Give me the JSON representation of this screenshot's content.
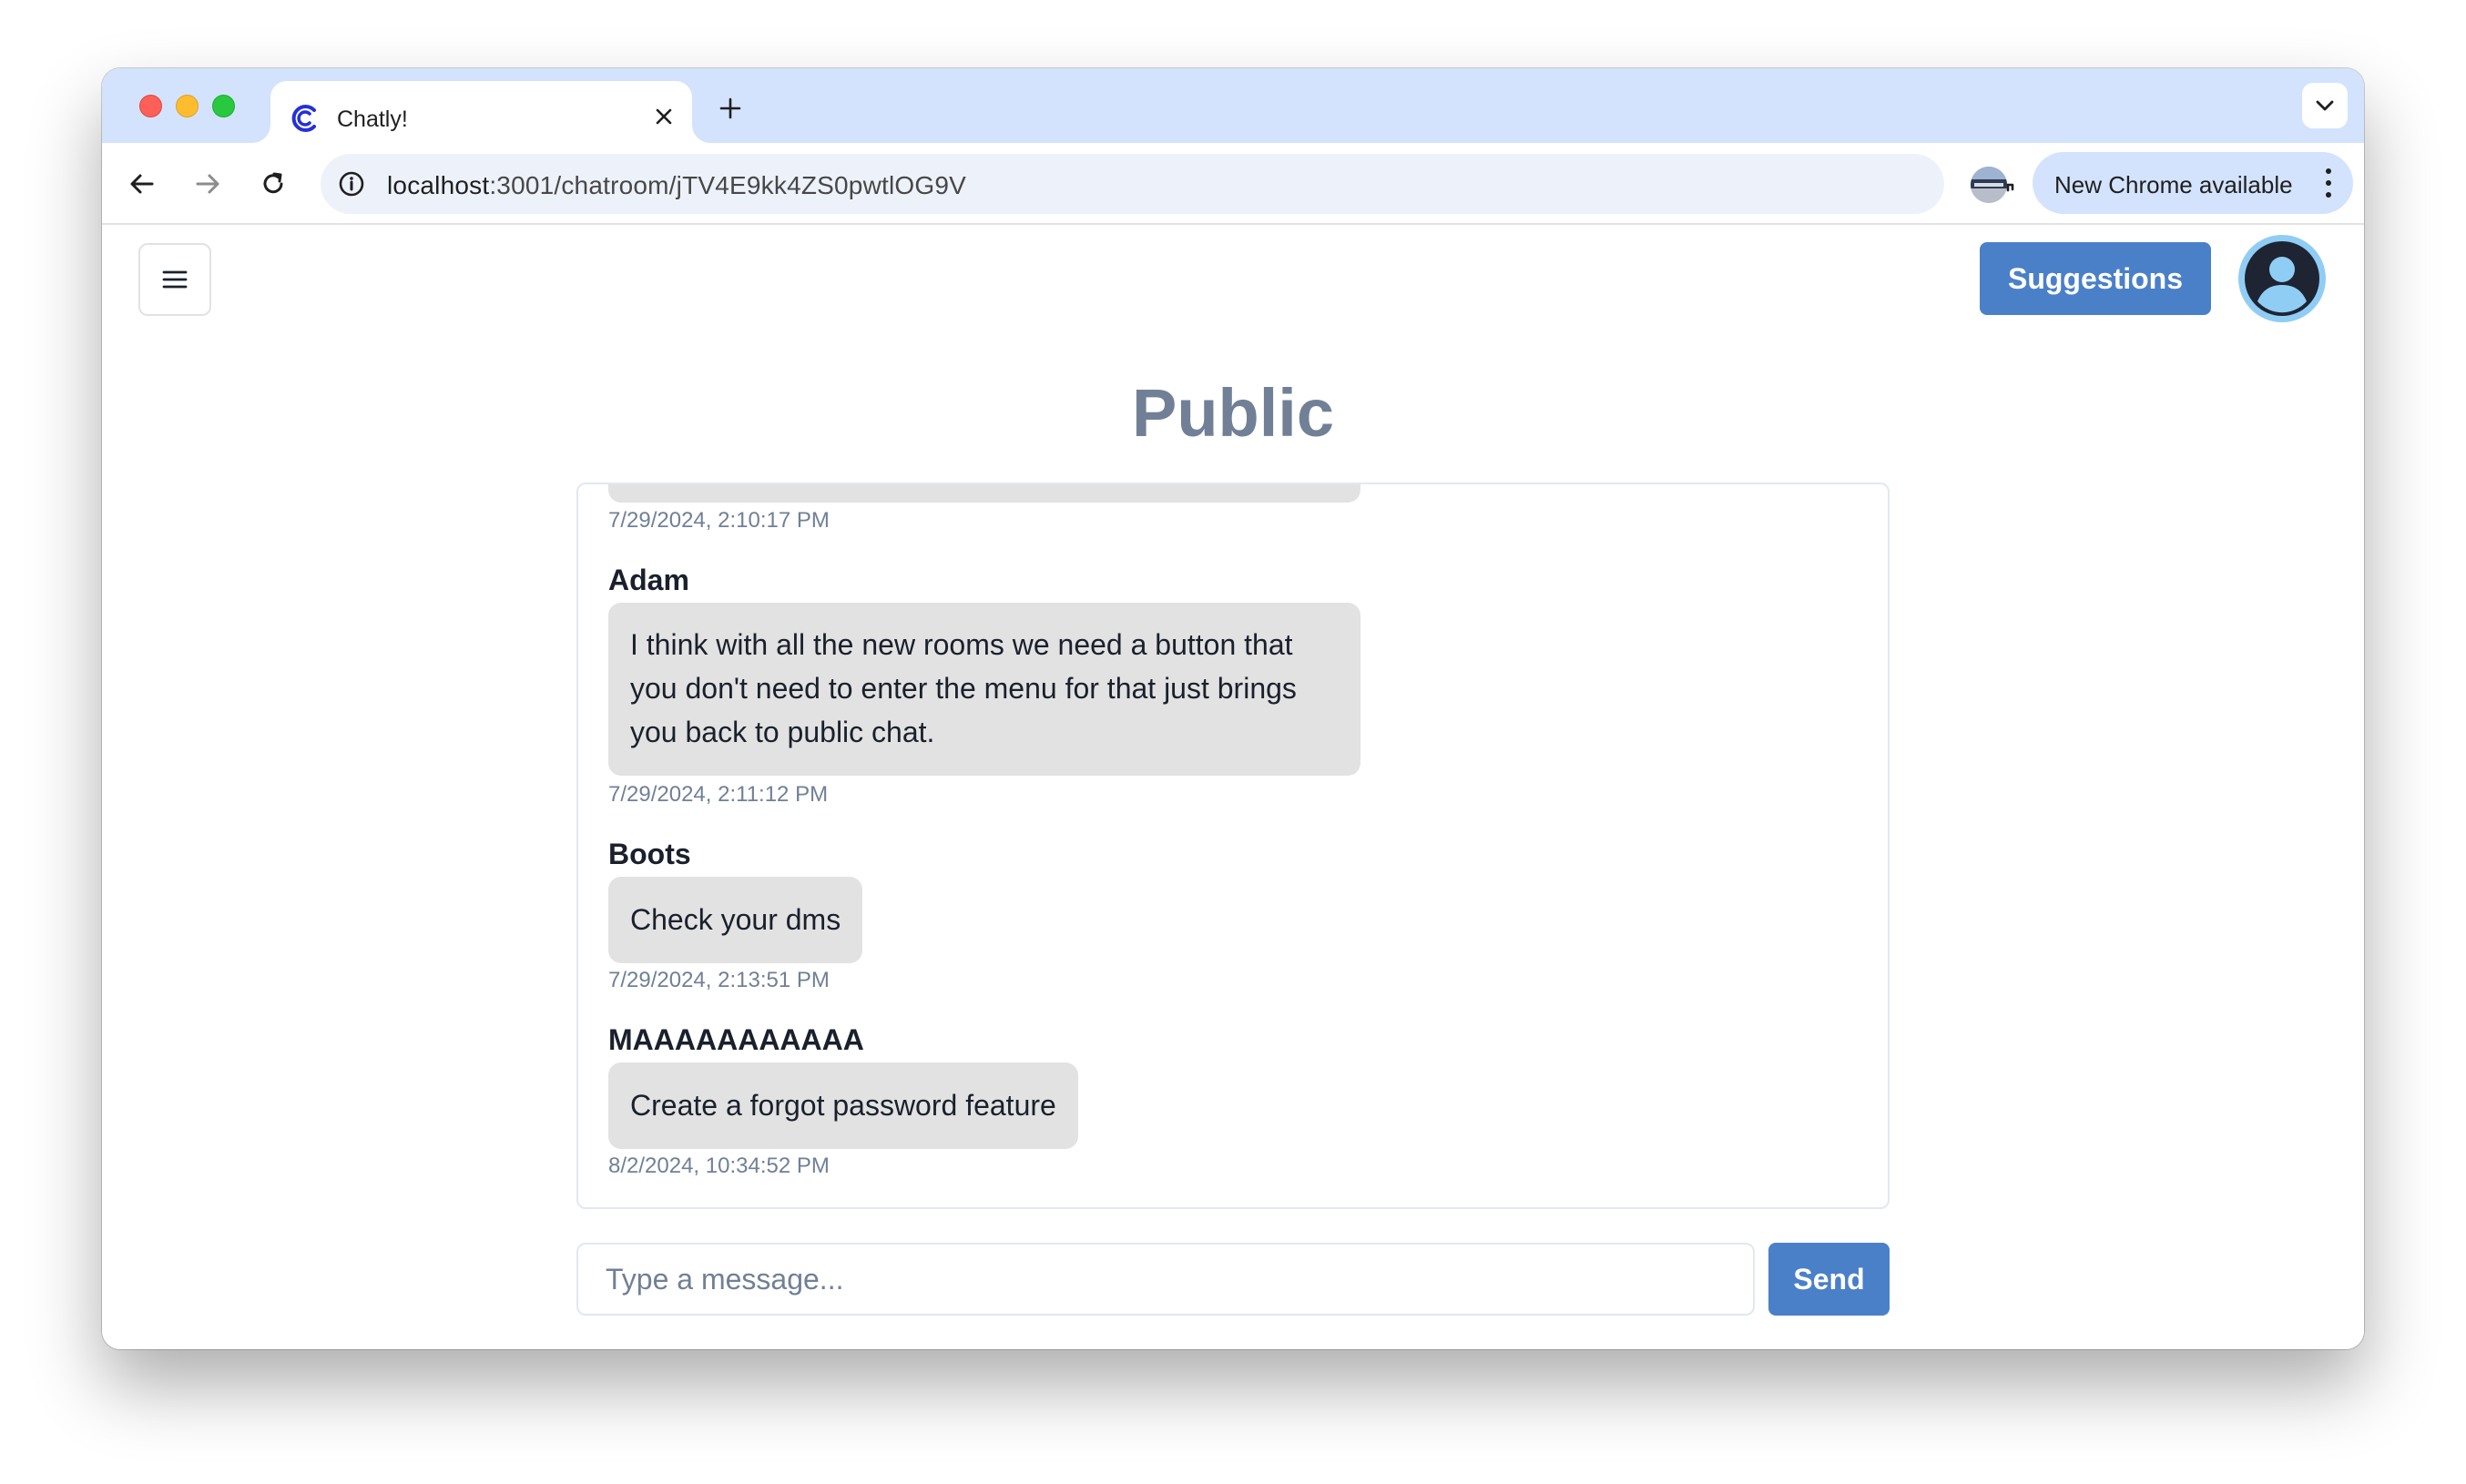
{
  "browser": {
    "tab": {
      "title": "Chatly!",
      "favicon": "chatly-c-logo"
    },
    "address_bar": {
      "host": "localhost",
      "path": ":3001/chatroom/jTV4E9kk4ZS0pwtlOG9V"
    },
    "update_pill": {
      "label": "New Chrome available"
    },
    "icons": [
      "back-icon",
      "forward-icon",
      "reload-icon",
      "info-icon",
      "key-icon",
      "install-icon",
      "star-icon",
      "more-vert-icon",
      "tab-search-icon",
      "close-icon",
      "plus-icon"
    ]
  },
  "app": {
    "header": {
      "suggestions_label": "Suggestions"
    },
    "room_title": "Public",
    "messages": [
      {
        "author": "",
        "text": "",
        "timestamp": "7/29/2024, 2:10:17 PM"
      },
      {
        "author": "Adam",
        "text_lines": [
          "I think with all the new rooms we need a button that",
          "you don't need to enter the menu for that just brings",
          "you back to public chat."
        ],
        "timestamp": "7/29/2024, 2:11:12 PM"
      },
      {
        "author": "Boots",
        "text": "Check your dms",
        "timestamp": "7/29/2024, 2:13:51 PM"
      },
      {
        "author": "MAAAAAAAAAAA",
        "text": "Create a forgot password feature",
        "timestamp": "8/2/2024, 10:34:52 PM"
      }
    ],
    "composer": {
      "placeholder": "Type a message...",
      "value": "",
      "send_label": "Send"
    },
    "colors": {
      "accent": "#4a80c8",
      "title": "#718096",
      "bubble": "#e2e2e2",
      "avatar_ring": "#90cdf4"
    }
  }
}
